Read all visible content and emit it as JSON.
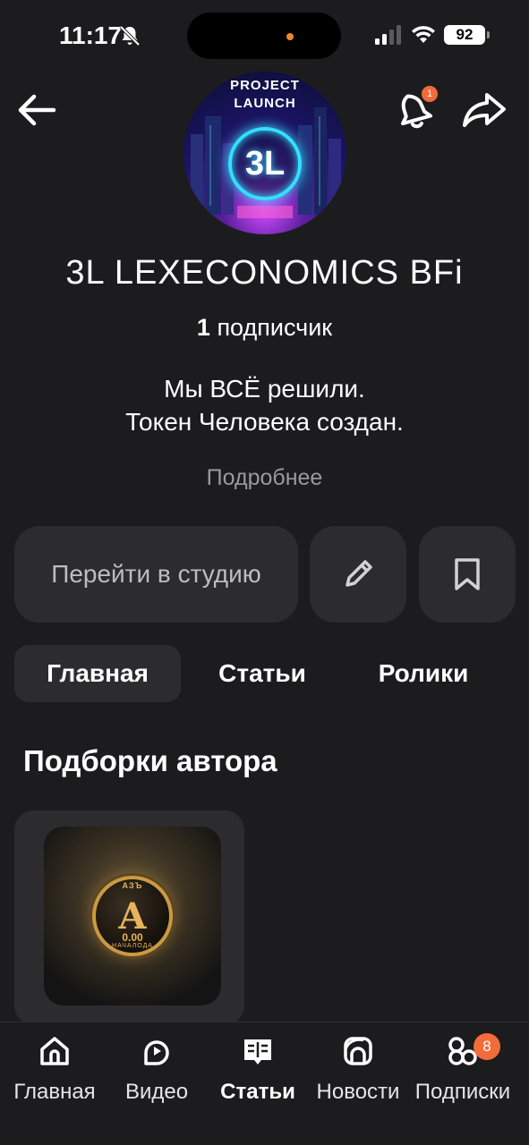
{
  "status_bar": {
    "time": "11:17",
    "battery": "92",
    "icons": [
      "bell-off-icon",
      "signal-icon",
      "wifi-icon",
      "battery-icon"
    ]
  },
  "header": {
    "back_icon": "arrow-left-icon",
    "notification_icon": "bell-icon",
    "notification_count": "1",
    "share_icon": "share-icon"
  },
  "avatar": {
    "title_line1": "PROJECT",
    "title_line2": "LAUNCH",
    "mark": "3L"
  },
  "channel": {
    "name": "3L LEXECONOMICS BFi",
    "subscriber_count": "1",
    "subscriber_label": "подписчик",
    "description_line1": "Мы ВСЁ решили.",
    "description_line2": "Токен Человека создан.",
    "more_link": "Подробнее"
  },
  "actions": {
    "studio_label": "Перейти в студию",
    "edit_icon": "pencil-icon",
    "bookmark_icon": "bookmark-icon"
  },
  "tabs": [
    {
      "label": "Главная",
      "active": true
    },
    {
      "label": "Статьи",
      "active": false
    },
    {
      "label": "Ролики",
      "active": false
    }
  ],
  "section": {
    "title": "Подборки автора"
  },
  "collection": {
    "coin_top": "АЗЪ",
    "coin_letter": "А",
    "coin_value": "0.00",
    "coin_bottom": "НАЧАЛОДА"
  },
  "bottom_nav": [
    {
      "label": "Главная",
      "icon": "home-icon",
      "active": false
    },
    {
      "label": "Видео",
      "icon": "video-icon",
      "active": false
    },
    {
      "label": "Статьи",
      "icon": "articles-icon",
      "active": true
    },
    {
      "label": "Новости",
      "icon": "news-icon",
      "active": false
    },
    {
      "label": "Подписки",
      "icon": "subscriptions-icon",
      "active": false,
      "badge": "8"
    }
  ],
  "colors": {
    "background": "#1c1c1e",
    "surface": "#2c2c2e",
    "badge": "#f26b3a",
    "muted": "#9a9a9e"
  }
}
